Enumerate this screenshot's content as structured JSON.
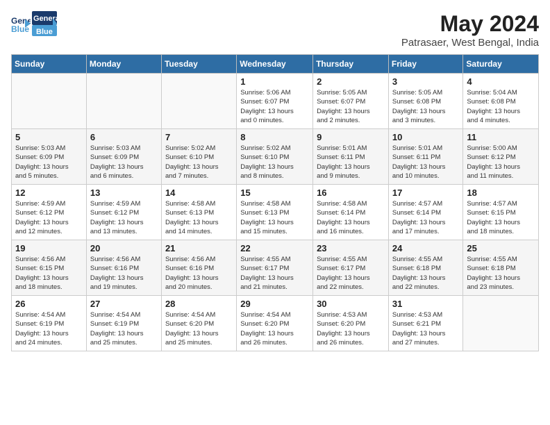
{
  "logo": {
    "line1": "General",
    "line2": "Blue"
  },
  "title": "May 2024",
  "location": "Patrasaer, West Bengal, India",
  "weekdays": [
    "Sunday",
    "Monday",
    "Tuesday",
    "Wednesday",
    "Thursday",
    "Friday",
    "Saturday"
  ],
  "weeks": [
    [
      {
        "day": "",
        "info": ""
      },
      {
        "day": "",
        "info": ""
      },
      {
        "day": "",
        "info": ""
      },
      {
        "day": "1",
        "info": "Sunrise: 5:06 AM\nSunset: 6:07 PM\nDaylight: 13 hours\nand 0 minutes."
      },
      {
        "day": "2",
        "info": "Sunrise: 5:05 AM\nSunset: 6:07 PM\nDaylight: 13 hours\nand 2 minutes."
      },
      {
        "day": "3",
        "info": "Sunrise: 5:05 AM\nSunset: 6:08 PM\nDaylight: 13 hours\nand 3 minutes."
      },
      {
        "day": "4",
        "info": "Sunrise: 5:04 AM\nSunset: 6:08 PM\nDaylight: 13 hours\nand 4 minutes."
      }
    ],
    [
      {
        "day": "5",
        "info": "Sunrise: 5:03 AM\nSunset: 6:09 PM\nDaylight: 13 hours\nand 5 minutes."
      },
      {
        "day": "6",
        "info": "Sunrise: 5:03 AM\nSunset: 6:09 PM\nDaylight: 13 hours\nand 6 minutes."
      },
      {
        "day": "7",
        "info": "Sunrise: 5:02 AM\nSunset: 6:10 PM\nDaylight: 13 hours\nand 7 minutes."
      },
      {
        "day": "8",
        "info": "Sunrise: 5:02 AM\nSunset: 6:10 PM\nDaylight: 13 hours\nand 8 minutes."
      },
      {
        "day": "9",
        "info": "Sunrise: 5:01 AM\nSunset: 6:11 PM\nDaylight: 13 hours\nand 9 minutes."
      },
      {
        "day": "10",
        "info": "Sunrise: 5:01 AM\nSunset: 6:11 PM\nDaylight: 13 hours\nand 10 minutes."
      },
      {
        "day": "11",
        "info": "Sunrise: 5:00 AM\nSunset: 6:12 PM\nDaylight: 13 hours\nand 11 minutes."
      }
    ],
    [
      {
        "day": "12",
        "info": "Sunrise: 4:59 AM\nSunset: 6:12 PM\nDaylight: 13 hours\nand 12 minutes."
      },
      {
        "day": "13",
        "info": "Sunrise: 4:59 AM\nSunset: 6:12 PM\nDaylight: 13 hours\nand 13 minutes."
      },
      {
        "day": "14",
        "info": "Sunrise: 4:58 AM\nSunset: 6:13 PM\nDaylight: 13 hours\nand 14 minutes."
      },
      {
        "day": "15",
        "info": "Sunrise: 4:58 AM\nSunset: 6:13 PM\nDaylight: 13 hours\nand 15 minutes."
      },
      {
        "day": "16",
        "info": "Sunrise: 4:58 AM\nSunset: 6:14 PM\nDaylight: 13 hours\nand 16 minutes."
      },
      {
        "day": "17",
        "info": "Sunrise: 4:57 AM\nSunset: 6:14 PM\nDaylight: 13 hours\nand 17 minutes."
      },
      {
        "day": "18",
        "info": "Sunrise: 4:57 AM\nSunset: 6:15 PM\nDaylight: 13 hours\nand 18 minutes."
      }
    ],
    [
      {
        "day": "19",
        "info": "Sunrise: 4:56 AM\nSunset: 6:15 PM\nDaylight: 13 hours\nand 18 minutes."
      },
      {
        "day": "20",
        "info": "Sunrise: 4:56 AM\nSunset: 6:16 PM\nDaylight: 13 hours\nand 19 minutes."
      },
      {
        "day": "21",
        "info": "Sunrise: 4:56 AM\nSunset: 6:16 PM\nDaylight: 13 hours\nand 20 minutes."
      },
      {
        "day": "22",
        "info": "Sunrise: 4:55 AM\nSunset: 6:17 PM\nDaylight: 13 hours\nand 21 minutes."
      },
      {
        "day": "23",
        "info": "Sunrise: 4:55 AM\nSunset: 6:17 PM\nDaylight: 13 hours\nand 22 minutes."
      },
      {
        "day": "24",
        "info": "Sunrise: 4:55 AM\nSunset: 6:18 PM\nDaylight: 13 hours\nand 22 minutes."
      },
      {
        "day": "25",
        "info": "Sunrise: 4:55 AM\nSunset: 6:18 PM\nDaylight: 13 hours\nand 23 minutes."
      }
    ],
    [
      {
        "day": "26",
        "info": "Sunrise: 4:54 AM\nSunset: 6:19 PM\nDaylight: 13 hours\nand 24 minutes."
      },
      {
        "day": "27",
        "info": "Sunrise: 4:54 AM\nSunset: 6:19 PM\nDaylight: 13 hours\nand 25 minutes."
      },
      {
        "day": "28",
        "info": "Sunrise: 4:54 AM\nSunset: 6:20 PM\nDaylight: 13 hours\nand 25 minutes."
      },
      {
        "day": "29",
        "info": "Sunrise: 4:54 AM\nSunset: 6:20 PM\nDaylight: 13 hours\nand 26 minutes."
      },
      {
        "day": "30",
        "info": "Sunrise: 4:53 AM\nSunset: 6:20 PM\nDaylight: 13 hours\nand 26 minutes."
      },
      {
        "day": "31",
        "info": "Sunrise: 4:53 AM\nSunset: 6:21 PM\nDaylight: 13 hours\nand 27 minutes."
      },
      {
        "day": "",
        "info": ""
      }
    ]
  ]
}
